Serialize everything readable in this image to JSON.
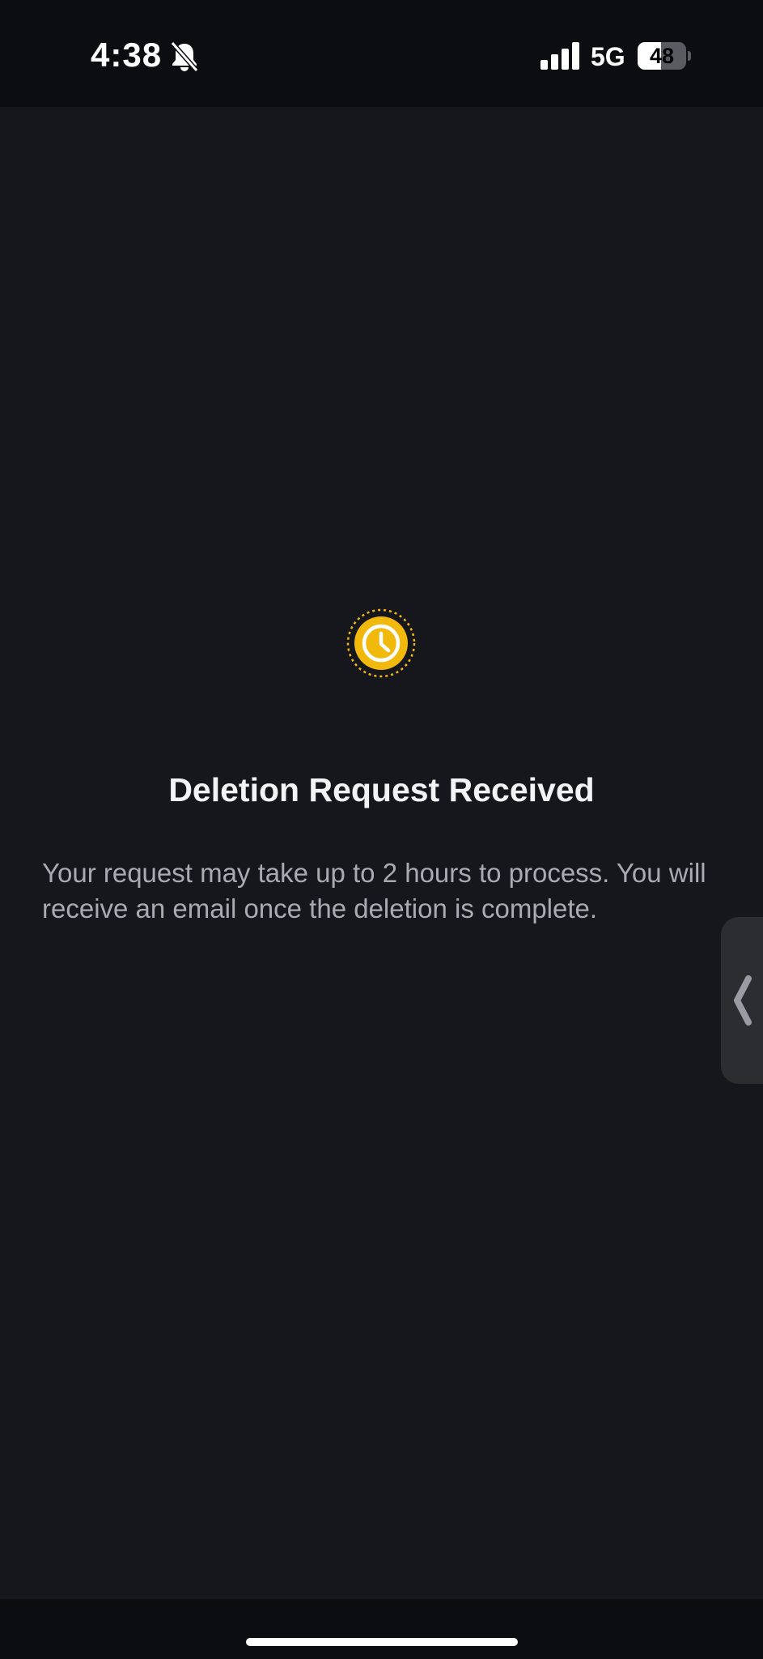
{
  "status_bar": {
    "time": "4:38",
    "network": "5G",
    "battery_level": "48",
    "battery_fraction": 0.48,
    "icons": [
      "bell-muted-icon",
      "cellular-signal-icon",
      "battery-icon"
    ]
  },
  "confirmation": {
    "icon": "clock-icon",
    "title": "Deletion Request Received",
    "message": "Your request may take up to 2 hours to process. You will receive an email once the deletion is complete."
  },
  "side_handle": {
    "icon": "chevron-left-icon"
  },
  "colors": {
    "accent": "#f0b90b",
    "background": "#16171c",
    "status_bar_background": "#0b0d10",
    "title_text": "#f2f3f5",
    "body_text": "#a8abb3"
  }
}
